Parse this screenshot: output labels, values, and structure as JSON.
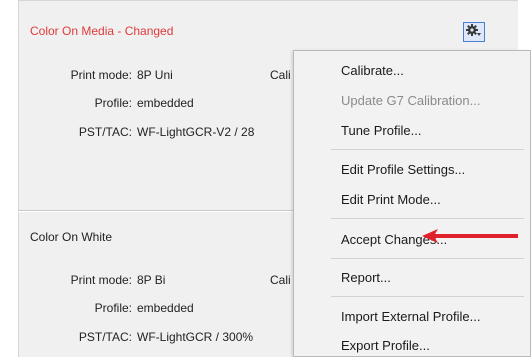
{
  "section1": {
    "title": "Color On Media - Changed",
    "print_mode_label": "Print mode:",
    "print_mode_value": "8P Uni",
    "calib_label": "Cali",
    "profile_label": "Profile:",
    "profile_value": "embedded",
    "pst_label": "PST/TAC:",
    "pst_value": "WF-LightGCR-V2 /  28"
  },
  "section2": {
    "title": "Color On White",
    "print_mode_label": "Print mode:",
    "print_mode_value": "8P Bi",
    "calib_label": "Cali",
    "profile_label": "Profile:",
    "profile_value": "embedded",
    "pst_label": "PST/TAC:",
    "pst_value": "WF-LightGCR /  300%"
  },
  "menu": {
    "items": [
      {
        "label": "Calibrate...",
        "enabled": true
      },
      {
        "label": "Update G7 Calibration...",
        "enabled": false
      },
      {
        "label": "Tune Profile...",
        "enabled": true
      },
      {
        "label": "Edit Profile Settings...",
        "enabled": true
      },
      {
        "label": "Edit Print Mode...",
        "enabled": true
      },
      {
        "label": "Accept Changes...",
        "enabled": true
      },
      {
        "label": "Report...",
        "enabled": true
      },
      {
        "label": "Import External Profile...",
        "enabled": true
      },
      {
        "label": "Export Profile...",
        "enabled": true
      }
    ]
  },
  "icons": {
    "gear": "gear-icon",
    "arrow": "red-arrow-icon"
  },
  "colors": {
    "changed_title": "#e03a3a",
    "arrow": "#e0202a",
    "gear_button_border": "#4a7fd0"
  }
}
